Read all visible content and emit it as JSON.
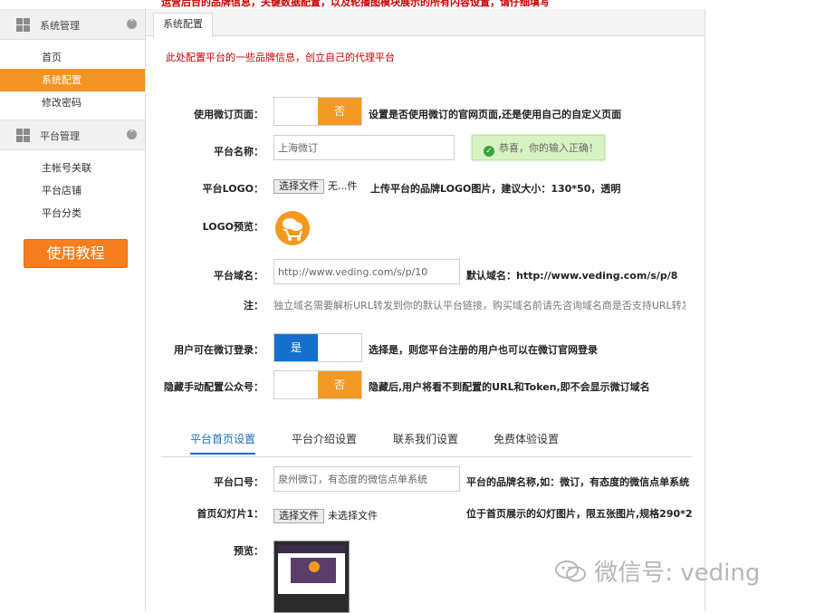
{
  "top_banner": "运营后台的品牌信息，关键数据配置，以及轮播图模块展示的所有内容设置，请仔细填写",
  "sidebar": {
    "sections": [
      {
        "title": "系统管理",
        "toggle": "⌃",
        "items": [
          {
            "label": "首页",
            "active": false
          },
          {
            "label": "系统配置",
            "active": true
          },
          {
            "label": "修改密码",
            "active": false
          }
        ]
      },
      {
        "title": "平台管理",
        "toggle": "⌃",
        "items": [
          {
            "label": "主帐号关联",
            "active": false
          },
          {
            "label": "平台店铺",
            "active": false
          },
          {
            "label": "平台分类",
            "active": false
          }
        ]
      }
    ],
    "tutorial_button": "使用教程"
  },
  "main": {
    "tab": "系统配置",
    "hint": "此处配置平台的一些品牌信息，创立自己的代理平台",
    "use_weiding_page": {
      "label": "使用微订页面：",
      "off_label": "否",
      "desc": "设置是否使用微订的官网页面,还是使用自己的自定义页面"
    },
    "platform_name": {
      "label": "平台名称：",
      "value": "上海微订",
      "success_tip": "恭喜，你的输入正确！",
      "success_icon": "check-icon"
    },
    "platform_logo": {
      "label": "平台LOGO：",
      "file_button": "选择文件",
      "file_status": "无...件",
      "desc": "上传平台的品牌LOGO图片，建议大小：130*50，透明"
    },
    "logo_preview": {
      "label": "LOGO预览：",
      "logo_color": "#f39a1e"
    },
    "platform_domain": {
      "label": "平台域名：",
      "value": "http://www.veding.com/s/p/10",
      "desc": "默认域名：http://www.veding.com/s/p/8"
    },
    "note": {
      "label": "注：",
      "text": "独立域名需要解析URL转发到你的默认平台链接，购买域名前请先咨询域名商是否支持URL转发。"
    },
    "user_login": {
      "label": "用户可在微订登录：",
      "on_label": "是",
      "desc": "选择是，则您平台注册的用户也可以在微订官网登录"
    },
    "hide_manual": {
      "label": "隐藏手动配置公众号：",
      "off_label": "否",
      "desc": "隐藏后,用户将看不到配置的URL和Token,即不会显示微订域名"
    },
    "subtabs": [
      {
        "label": "平台首页设置",
        "active": true
      },
      {
        "label": "平台介绍设置",
        "active": false
      },
      {
        "label": "联系我们设置",
        "active": false
      },
      {
        "label": "免费体验设置",
        "active": false
      }
    ],
    "platform_slogan": {
      "label": "平台口号：",
      "value": "泉州微订，有态度的微信点单系统",
      "desc": "平台的品牌名称,如：微订，有态度的微信点单系统"
    },
    "home_slide1": {
      "label": "首页幻灯片1：",
      "file_button": "选择文件",
      "file_status": "未选择文件",
      "desc": "位于首页展示的幻灯图片，限五张图片,规格290*2"
    },
    "preview": {
      "label": "预览："
    }
  },
  "watermark": "微信号: veding",
  "colors": {
    "accent_orange": "#f29423",
    "switch_blue": "#1470cc",
    "link_blue": "#1a6fc6",
    "error_red": "#cc0000"
  }
}
